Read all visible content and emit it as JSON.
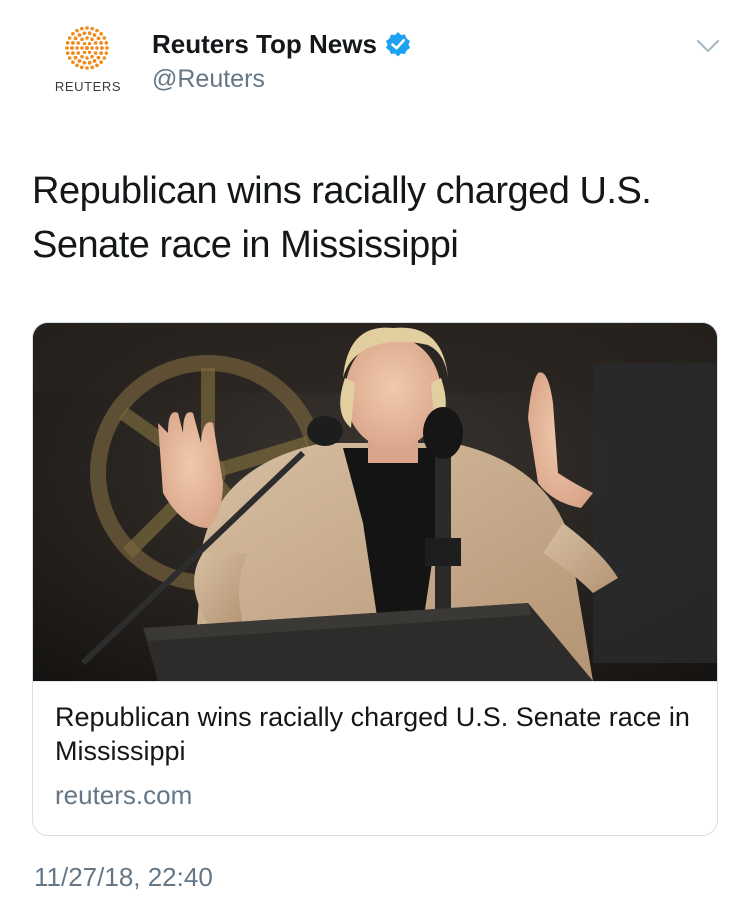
{
  "account": {
    "logo_text": "REUTERS",
    "display_name": "Reuters Top News",
    "handle": "@Reuters",
    "verified": true
  },
  "icons": {
    "logo": "reuters-logo-icon",
    "verified": "verified-badge-icon",
    "menu": "chevron-down-icon"
  },
  "colors": {
    "logo_orange": "#f08a1c",
    "verified_blue": "#1da1f2",
    "secondary_text": "#657786",
    "card_border": "#d8dee3"
  },
  "tweet": {
    "text": "Republican wins racially charged U.S. Senate race in Mississippi",
    "timestamp": "11/27/18, 22:40"
  },
  "card": {
    "image_description_icon": "news-photo",
    "title": "Republican wins racially charged U.S. Senate race in Mississippi",
    "domain": "reuters.com"
  }
}
